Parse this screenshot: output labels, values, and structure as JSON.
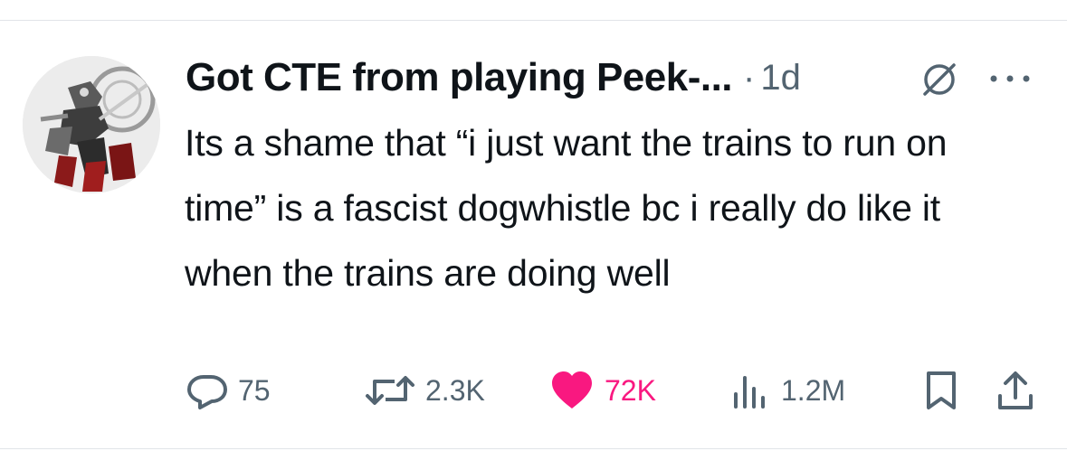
{
  "post": {
    "author_name": "Got CTE from playing Peek-...",
    "separator": "·",
    "time": "1d",
    "text": "Its a shame that “i just want the trains to run on time” is a fascist dogwhistle bc i really do like it when the trains are doing well"
  },
  "icons": {
    "grok": "grok-icon",
    "more": "more-icon",
    "reply": "reply-icon",
    "repost": "repost-icon",
    "like": "heart-icon",
    "views": "views-icon",
    "bookmark": "bookmark-icon",
    "share": "share-icon"
  },
  "actions": {
    "replies": "75",
    "reposts": "2.3K",
    "likes": "72K",
    "views": "1.2M",
    "liked": true
  },
  "colors": {
    "text": "#0f1419",
    "secondary": "#536471",
    "like": "#f91880",
    "divider": "#e1e4e8"
  }
}
